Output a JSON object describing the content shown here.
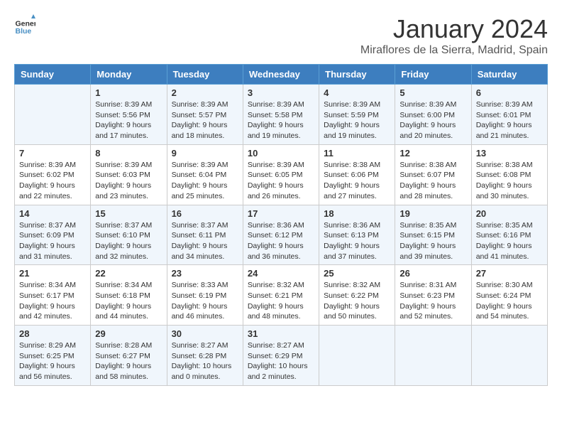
{
  "logo": {
    "text_general": "General",
    "text_blue": "Blue"
  },
  "title": "January 2024",
  "subtitle": "Miraflores de la Sierra, Madrid, Spain",
  "days_of_week": [
    "Sunday",
    "Monday",
    "Tuesday",
    "Wednesday",
    "Thursday",
    "Friday",
    "Saturday"
  ],
  "weeks": [
    [
      {
        "day": "",
        "info": ""
      },
      {
        "day": "1",
        "info": "Sunrise: 8:39 AM\nSunset: 5:56 PM\nDaylight: 9 hours\nand 17 minutes."
      },
      {
        "day": "2",
        "info": "Sunrise: 8:39 AM\nSunset: 5:57 PM\nDaylight: 9 hours\nand 18 minutes."
      },
      {
        "day": "3",
        "info": "Sunrise: 8:39 AM\nSunset: 5:58 PM\nDaylight: 9 hours\nand 19 minutes."
      },
      {
        "day": "4",
        "info": "Sunrise: 8:39 AM\nSunset: 5:59 PM\nDaylight: 9 hours\nand 19 minutes."
      },
      {
        "day": "5",
        "info": "Sunrise: 8:39 AM\nSunset: 6:00 PM\nDaylight: 9 hours\nand 20 minutes."
      },
      {
        "day": "6",
        "info": "Sunrise: 8:39 AM\nSunset: 6:01 PM\nDaylight: 9 hours\nand 21 minutes."
      }
    ],
    [
      {
        "day": "7",
        "info": "Sunrise: 8:39 AM\nSunset: 6:02 PM\nDaylight: 9 hours\nand 22 minutes."
      },
      {
        "day": "8",
        "info": "Sunrise: 8:39 AM\nSunset: 6:03 PM\nDaylight: 9 hours\nand 23 minutes."
      },
      {
        "day": "9",
        "info": "Sunrise: 8:39 AM\nSunset: 6:04 PM\nDaylight: 9 hours\nand 25 minutes."
      },
      {
        "day": "10",
        "info": "Sunrise: 8:39 AM\nSunset: 6:05 PM\nDaylight: 9 hours\nand 26 minutes."
      },
      {
        "day": "11",
        "info": "Sunrise: 8:38 AM\nSunset: 6:06 PM\nDaylight: 9 hours\nand 27 minutes."
      },
      {
        "day": "12",
        "info": "Sunrise: 8:38 AM\nSunset: 6:07 PM\nDaylight: 9 hours\nand 28 minutes."
      },
      {
        "day": "13",
        "info": "Sunrise: 8:38 AM\nSunset: 6:08 PM\nDaylight: 9 hours\nand 30 minutes."
      }
    ],
    [
      {
        "day": "14",
        "info": "Sunrise: 8:37 AM\nSunset: 6:09 PM\nDaylight: 9 hours\nand 31 minutes."
      },
      {
        "day": "15",
        "info": "Sunrise: 8:37 AM\nSunset: 6:10 PM\nDaylight: 9 hours\nand 32 minutes."
      },
      {
        "day": "16",
        "info": "Sunrise: 8:37 AM\nSunset: 6:11 PM\nDaylight: 9 hours\nand 34 minutes."
      },
      {
        "day": "17",
        "info": "Sunrise: 8:36 AM\nSunset: 6:12 PM\nDaylight: 9 hours\nand 36 minutes."
      },
      {
        "day": "18",
        "info": "Sunrise: 8:36 AM\nSunset: 6:13 PM\nDaylight: 9 hours\nand 37 minutes."
      },
      {
        "day": "19",
        "info": "Sunrise: 8:35 AM\nSunset: 6:15 PM\nDaylight: 9 hours\nand 39 minutes."
      },
      {
        "day": "20",
        "info": "Sunrise: 8:35 AM\nSunset: 6:16 PM\nDaylight: 9 hours\nand 41 minutes."
      }
    ],
    [
      {
        "day": "21",
        "info": "Sunrise: 8:34 AM\nSunset: 6:17 PM\nDaylight: 9 hours\nand 42 minutes."
      },
      {
        "day": "22",
        "info": "Sunrise: 8:34 AM\nSunset: 6:18 PM\nDaylight: 9 hours\nand 44 minutes."
      },
      {
        "day": "23",
        "info": "Sunrise: 8:33 AM\nSunset: 6:19 PM\nDaylight: 9 hours\nand 46 minutes."
      },
      {
        "day": "24",
        "info": "Sunrise: 8:32 AM\nSunset: 6:21 PM\nDaylight: 9 hours\nand 48 minutes."
      },
      {
        "day": "25",
        "info": "Sunrise: 8:32 AM\nSunset: 6:22 PM\nDaylight: 9 hours\nand 50 minutes."
      },
      {
        "day": "26",
        "info": "Sunrise: 8:31 AM\nSunset: 6:23 PM\nDaylight: 9 hours\nand 52 minutes."
      },
      {
        "day": "27",
        "info": "Sunrise: 8:30 AM\nSunset: 6:24 PM\nDaylight: 9 hours\nand 54 minutes."
      }
    ],
    [
      {
        "day": "28",
        "info": "Sunrise: 8:29 AM\nSunset: 6:25 PM\nDaylight: 9 hours\nand 56 minutes."
      },
      {
        "day": "29",
        "info": "Sunrise: 8:28 AM\nSunset: 6:27 PM\nDaylight: 9 hours\nand 58 minutes."
      },
      {
        "day": "30",
        "info": "Sunrise: 8:27 AM\nSunset: 6:28 PM\nDaylight: 10 hours\nand 0 minutes."
      },
      {
        "day": "31",
        "info": "Sunrise: 8:27 AM\nSunset: 6:29 PM\nDaylight: 10 hours\nand 2 minutes."
      },
      {
        "day": "",
        "info": ""
      },
      {
        "day": "",
        "info": ""
      },
      {
        "day": "",
        "info": ""
      }
    ]
  ]
}
